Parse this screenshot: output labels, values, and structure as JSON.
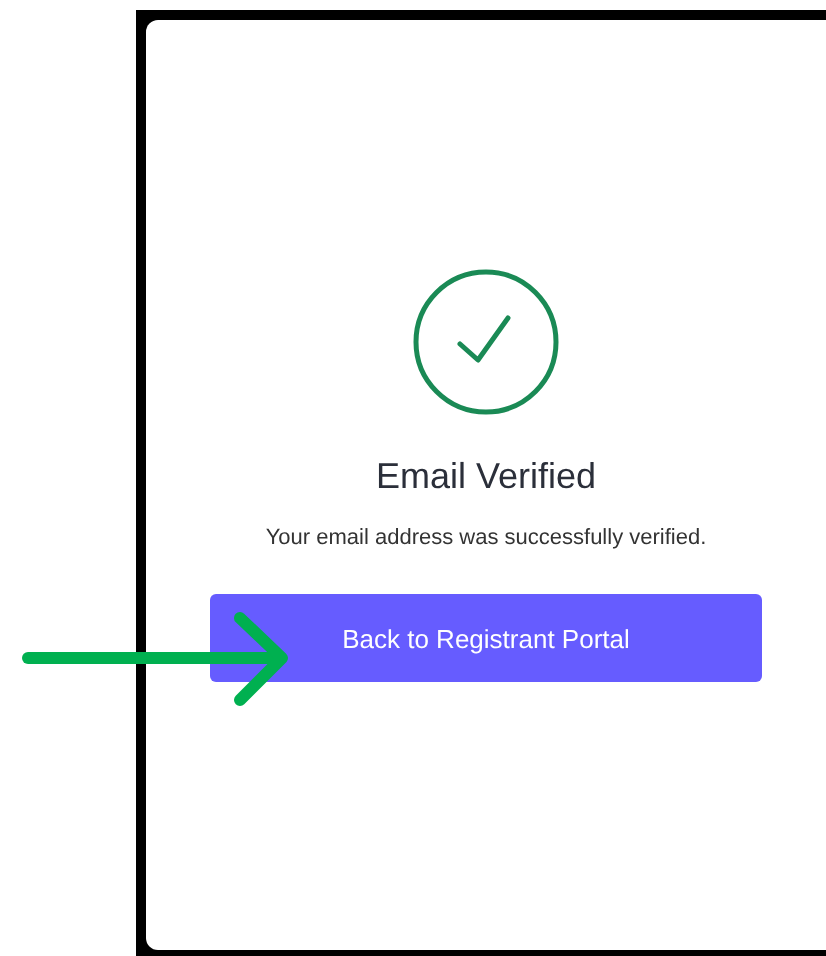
{
  "card": {
    "title": "Email Verified",
    "message": "Your email address was successfully verified.",
    "button": "Back to Registrant Portal"
  },
  "annotation": {
    "kind": "arrow",
    "color": "#00b050"
  }
}
